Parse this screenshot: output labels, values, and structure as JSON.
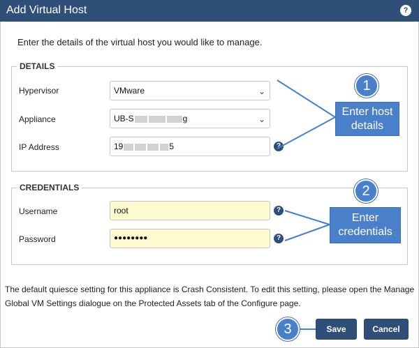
{
  "dialog": {
    "title": "Add Virtual Host",
    "help_glyph": "?",
    "intro": "Enter the details of the virtual host you would like to manage."
  },
  "details": {
    "legend": "DETAILS",
    "hypervisor": {
      "label": "Hypervisor",
      "value": "VMware"
    },
    "appliance": {
      "label": "Appliance",
      "value_prefix": "UB-S",
      "value_suffix": "g"
    },
    "ip": {
      "label": "IP Address",
      "value_prefix": "19",
      "value_suffix": "5"
    }
  },
  "credentials": {
    "legend": "CREDENTIALS",
    "username": {
      "label": "Username",
      "value": "root"
    },
    "password": {
      "label": "Password",
      "value": "●●●●●●●●"
    }
  },
  "callouts": {
    "step1": {
      "number": "1",
      "text": "Enter host details"
    },
    "step2": {
      "number": "2",
      "text": "Enter credentials"
    },
    "step3": {
      "number": "3"
    }
  },
  "footer": {
    "note": "The default quiesce setting for this appliance is Crash Consistent. To edit this setting, please open the Manage Global VM Settings dialogue on the Protected Assets tab of the Configure page.",
    "save_label": "Save",
    "cancel_label": "Cancel"
  },
  "colors": {
    "titlebar": "#2f4e78",
    "callout": "#4a7fc9",
    "credential_field": "#fdfbd0"
  },
  "icons": {
    "dropdown": "chevron-down-icon",
    "help": "question-circle-icon"
  }
}
